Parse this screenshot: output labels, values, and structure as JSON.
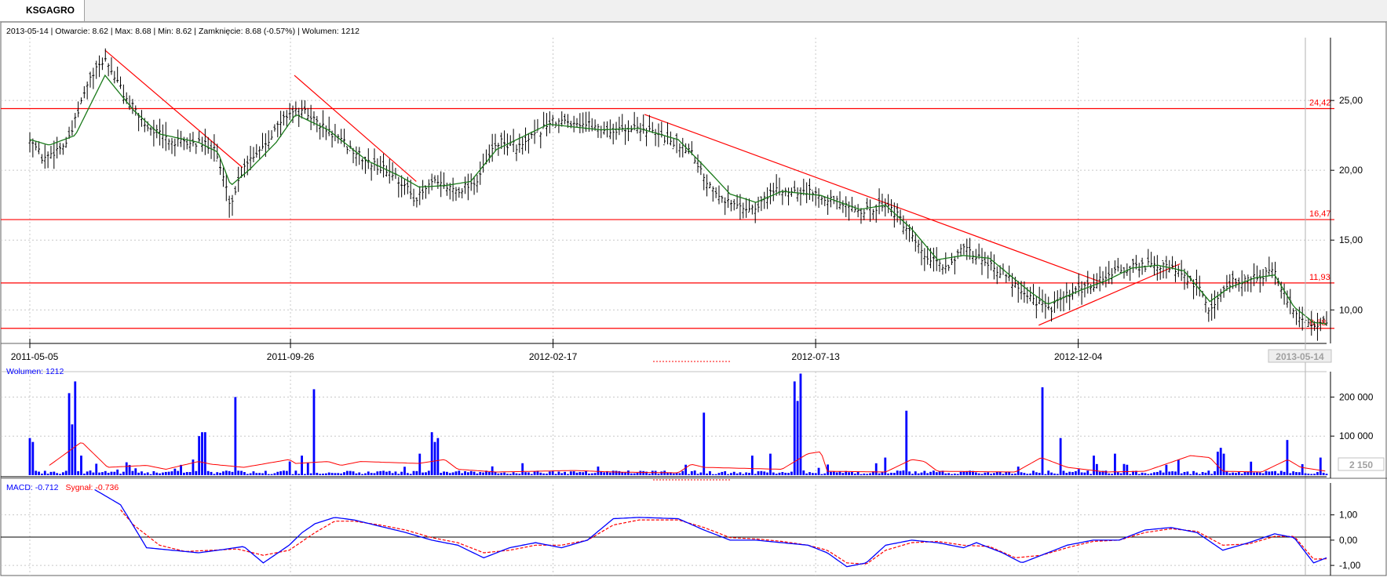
{
  "tab": {
    "label": "KSGAGRO"
  },
  "header": {
    "info": "2013-05-14 | Otwarcie: 8.62 | Max: 8.68 | Min: 8.62 | Zamknięcie: 8.68 (-0.57%)  | Wolumen: 1212"
  },
  "colors": {
    "price_bar": "#000000",
    "ma_line": "#1a7a1a",
    "support_line": "#ff0000",
    "volume_bar": "#0000ff",
    "volume_avg": "#ff0000",
    "macd_line": "#0000ff",
    "signal_line": "#ff0000",
    "grid": "#c8c8c8"
  },
  "chart_data": [
    {
      "type": "ohlc",
      "title": "",
      "x_ticks": [
        "2011-05-05",
        "2011-09-26",
        "2012-02-17",
        "2012-07-13",
        "2012-12-04"
      ],
      "last_date_label": "2013-05-14",
      "y_ticks": [
        "25,00",
        "20,00",
        "15,00",
        "10,00"
      ],
      "ylim": [
        7.6,
        29.5
      ],
      "horizontal_levels": [
        {
          "label": "24,42",
          "value": 24.42
        },
        {
          "label": "16,47",
          "value": 16.47
        },
        {
          "label": "11,93",
          "value": 11.93
        },
        {
          "label": "8,68",
          "value": 8.68
        }
      ],
      "trendlines": [
        {
          "from": [
            0.058,
            28.6
          ],
          "to": [
            0.164,
            20.2
          ]
        },
        {
          "from": [
            0.204,
            26.8
          ],
          "to": [
            0.298,
            19.2
          ]
        },
        {
          "from": [
            0.474,
            24.0
          ],
          "to": [
            0.826,
            12.0
          ]
        },
        {
          "from": [
            0.778,
            8.9
          ],
          "to": [
            0.887,
            13.3
          ]
        }
      ],
      "price_anchors": [
        [
          0.0,
          22.4
        ],
        [
          0.01,
          20.8
        ],
        [
          0.03,
          22.1
        ],
        [
          0.045,
          26.3
        ],
        [
          0.058,
          28.0
        ],
        [
          0.075,
          25.0
        ],
        [
          0.09,
          23.2
        ],
        [
          0.11,
          22.0
        ],
        [
          0.13,
          21.9
        ],
        [
          0.142,
          21.8
        ],
        [
          0.155,
          17.5
        ],
        [
          0.165,
          20.4
        ],
        [
          0.18,
          21.8
        ],
        [
          0.2,
          24.2
        ],
        [
          0.213,
          24.1
        ],
        [
          0.23,
          22.8
        ],
        [
          0.26,
          20.6
        ],
        [
          0.28,
          19.8
        ],
        [
          0.298,
          17.9
        ],
        [
          0.31,
          19.1
        ],
        [
          0.33,
          18.6
        ],
        [
          0.345,
          19.3
        ],
        [
          0.36,
          22.0
        ],
        [
          0.38,
          21.7
        ],
        [
          0.4,
          23.4
        ],
        [
          0.42,
          23.5
        ],
        [
          0.45,
          22.8
        ],
        [
          0.47,
          23.1
        ],
        [
          0.49,
          22.3
        ],
        [
          0.51,
          21.5
        ],
        [
          0.52,
          19.5
        ],
        [
          0.54,
          17.6
        ],
        [
          0.56,
          17.2
        ],
        [
          0.57,
          18.4
        ],
        [
          0.59,
          18.6
        ],
        [
          0.61,
          18.3
        ],
        [
          0.63,
          17.3
        ],
        [
          0.65,
          17.1
        ],
        [
          0.66,
          17.8
        ],
        [
          0.67,
          16.6
        ],
        [
          0.69,
          13.8
        ],
        [
          0.705,
          13.0
        ],
        [
          0.72,
          14.3
        ],
        [
          0.74,
          13.4
        ],
        [
          0.77,
          11.1
        ],
        [
          0.785,
          10.0
        ],
        [
          0.8,
          11.0
        ],
        [
          0.82,
          11.8
        ],
        [
          0.835,
          12.7
        ],
        [
          0.86,
          13.2
        ],
        [
          0.88,
          13.0
        ],
        [
          0.9,
          11.7
        ],
        [
          0.91,
          10.0
        ],
        [
          0.925,
          12.0
        ],
        [
          0.94,
          12.2
        ],
        [
          0.96,
          12.7
        ],
        [
          0.97,
          10.6
        ],
        [
          0.985,
          9.0
        ],
        [
          1.0,
          9.1
        ]
      ],
      "ma_anchors": [
        [
          0.0,
          22.2
        ],
        [
          0.015,
          21.8
        ],
        [
          0.035,
          22.5
        ],
        [
          0.058,
          26.8
        ],
        [
          0.08,
          24.3
        ],
        [
          0.1,
          22.6
        ],
        [
          0.13,
          22.0
        ],
        [
          0.145,
          21.3
        ],
        [
          0.155,
          18.9
        ],
        [
          0.17,
          20.1
        ],
        [
          0.19,
          22.0
        ],
        [
          0.205,
          24.0
        ],
        [
          0.23,
          22.9
        ],
        [
          0.26,
          20.7
        ],
        [
          0.285,
          19.6
        ],
        [
          0.3,
          18.8
        ],
        [
          0.32,
          18.9
        ],
        [
          0.34,
          19.2
        ],
        [
          0.36,
          21.5
        ],
        [
          0.4,
          23.3
        ],
        [
          0.44,
          22.9
        ],
        [
          0.47,
          23.0
        ],
        [
          0.5,
          22.2
        ],
        [
          0.52,
          20.3
        ],
        [
          0.54,
          18.3
        ],
        [
          0.56,
          17.7
        ],
        [
          0.58,
          18.5
        ],
        [
          0.61,
          18.2
        ],
        [
          0.64,
          17.2
        ],
        [
          0.66,
          17.5
        ],
        [
          0.68,
          15.8
        ],
        [
          0.7,
          13.6
        ],
        [
          0.72,
          13.9
        ],
        [
          0.74,
          13.7
        ],
        [
          0.77,
          11.4
        ],
        [
          0.785,
          10.4
        ],
        [
          0.81,
          11.4
        ],
        [
          0.83,
          12.1
        ],
        [
          0.85,
          13.0
        ],
        [
          0.87,
          13.2
        ],
        [
          0.89,
          12.8
        ],
        [
          0.91,
          10.6
        ],
        [
          0.925,
          11.6
        ],
        [
          0.945,
          12.3
        ],
        [
          0.96,
          12.5
        ],
        [
          0.975,
          10.2
        ],
        [
          0.99,
          9.1
        ],
        [
          1.0,
          9.0
        ]
      ],
      "marker_label": "8,68"
    },
    {
      "type": "bar",
      "title": "Wolumen: 1212",
      "y_ticks": [
        "200 000",
        "100 000"
      ],
      "ylim": [
        0,
        265000
      ],
      "last_value_label": "2 150",
      "spikes": [
        [
          0.0,
          95000
        ],
        [
          0.003,
          85000
        ],
        [
          0.03,
          210000
        ],
        [
          0.033,
          130000
        ],
        [
          0.036,
          240000
        ],
        [
          0.04,
          50000
        ],
        [
          0.125,
          40000
        ],
        [
          0.13,
          100000
        ],
        [
          0.134,
          110000
        ],
        [
          0.158,
          200000
        ],
        [
          0.2,
          35000
        ],
        [
          0.21,
          50000
        ],
        [
          0.218,
          220000
        ],
        [
          0.3,
          55000
        ],
        [
          0.31,
          110000
        ],
        [
          0.312,
          85000
        ],
        [
          0.315,
          95000
        ],
        [
          0.52,
          160000
        ],
        [
          0.556,
          50000
        ],
        [
          0.57,
          55000
        ],
        [
          0.59,
          240000
        ],
        [
          0.593,
          190000
        ],
        [
          0.595,
          260000
        ],
        [
          0.66,
          45000
        ],
        [
          0.675,
          165000
        ],
        [
          0.78,
          225000
        ],
        [
          0.796,
          95000
        ],
        [
          0.82,
          50000
        ],
        [
          0.836,
          55000
        ],
        [
          0.885,
          40000
        ],
        [
          0.915,
          60000
        ],
        [
          0.918,
          70000
        ],
        [
          0.92,
          55000
        ],
        [
          0.97,
          90000
        ],
        [
          0.995,
          45000
        ]
      ],
      "avg_anchors": [
        [
          0.015,
          25000
        ],
        [
          0.04,
          85000
        ],
        [
          0.06,
          20000
        ],
        [
          0.09,
          25000
        ],
        [
          0.105,
          15000
        ],
        [
          0.13,
          35000
        ],
        [
          0.14,
          28000
        ],
        [
          0.165,
          20000
        ],
        [
          0.2,
          40000
        ],
        [
          0.205,
          30000
        ],
        [
          0.23,
          35000
        ],
        [
          0.24,
          25000
        ],
        [
          0.255,
          35000
        ],
        [
          0.3,
          30000
        ],
        [
          0.32,
          40000
        ],
        [
          0.33,
          15000
        ],
        [
          0.36,
          8000
        ],
        [
          0.42,
          12000
        ],
        [
          0.45,
          8000
        ],
        [
          0.5,
          6000
        ],
        [
          0.51,
          28000
        ],
        [
          0.52,
          20000
        ],
        [
          0.58,
          15000
        ],
        [
          0.6,
          55000
        ],
        [
          0.61,
          60000
        ],
        [
          0.615,
          10000
        ],
        [
          0.66,
          8000
        ],
        [
          0.68,
          40000
        ],
        [
          0.69,
          35000
        ],
        [
          0.7,
          10000
        ],
        [
          0.76,
          8000
        ],
        [
          0.78,
          45000
        ],
        [
          0.8,
          20000
        ],
        [
          0.83,
          8000
        ],
        [
          0.86,
          10000
        ],
        [
          0.895,
          50000
        ],
        [
          0.91,
          45000
        ],
        [
          0.92,
          10000
        ],
        [
          0.95,
          8000
        ],
        [
          0.97,
          40000
        ],
        [
          0.98,
          20000
        ],
        [
          1.0,
          10000
        ]
      ],
      "base_level": 6000
    },
    {
      "type": "line",
      "title": "MACD: -0.712  Sygnał: -0.736",
      "y_ticks": [
        "1,00",
        "0,00",
        "-1,00"
      ],
      "ylim": [
        -1.4,
        2.2
      ],
      "series": [
        {
          "name": "MACD: -0.712",
          "anchors": [
            [
              0.05,
              2.0
            ],
            [
              0.07,
              1.4
            ],
            [
              0.09,
              -0.3
            ],
            [
              0.11,
              -0.4
            ],
            [
              0.13,
              -0.5
            ],
            [
              0.145,
              -0.4
            ],
            [
              0.165,
              -0.25
            ],
            [
              0.18,
              -0.9
            ],
            [
              0.2,
              -0.2
            ],
            [
              0.21,
              0.3
            ],
            [
              0.22,
              0.65
            ],
            [
              0.235,
              0.9
            ],
            [
              0.25,
              0.8
            ],
            [
              0.27,
              0.55
            ],
            [
              0.29,
              0.3
            ],
            [
              0.31,
              0.0
            ],
            [
              0.33,
              -0.2
            ],
            [
              0.35,
              -0.7
            ],
            [
              0.37,
              -0.3
            ],
            [
              0.39,
              -0.1
            ],
            [
              0.41,
              -0.3
            ],
            [
              0.43,
              0.0
            ],
            [
              0.45,
              0.85
            ],
            [
              0.47,
              0.9
            ],
            [
              0.5,
              0.85
            ],
            [
              0.52,
              0.4
            ],
            [
              0.54,
              0.0
            ],
            [
              0.56,
              0.0
            ],
            [
              0.58,
              -0.1
            ],
            [
              0.6,
              -0.2
            ],
            [
              0.615,
              -0.5
            ],
            [
              0.63,
              -1.05
            ],
            [
              0.645,
              -0.9
            ],
            [
              0.66,
              -0.2
            ],
            [
              0.68,
              0.0
            ],
            [
              0.7,
              -0.1
            ],
            [
              0.72,
              -0.3
            ],
            [
              0.73,
              -0.1
            ],
            [
              0.75,
              -0.5
            ],
            [
              0.765,
              -0.9
            ],
            [
              0.78,
              -0.6
            ],
            [
              0.8,
              -0.2
            ],
            [
              0.82,
              0.0
            ],
            [
              0.84,
              0.0
            ],
            [
              0.86,
              0.4
            ],
            [
              0.88,
              0.5
            ],
            [
              0.9,
              0.3
            ],
            [
              0.92,
              -0.4
            ],
            [
              0.94,
              -0.1
            ],
            [
              0.96,
              0.25
            ],
            [
              0.975,
              0.1
            ],
            [
              0.99,
              -0.9
            ],
            [
              1.0,
              -0.7
            ]
          ]
        },
        {
          "name": "Sygnał: -0.736",
          "anchors": [
            [
              0.07,
              1.2
            ],
            [
              0.08,
              0.6
            ],
            [
              0.1,
              -0.2
            ],
            [
              0.12,
              -0.45
            ],
            [
              0.14,
              -0.4
            ],
            [
              0.16,
              -0.35
            ],
            [
              0.18,
              -0.6
            ],
            [
              0.2,
              -0.4
            ],
            [
              0.22,
              0.3
            ],
            [
              0.235,
              0.75
            ],
            [
              0.25,
              0.75
            ],
            [
              0.27,
              0.6
            ],
            [
              0.29,
              0.4
            ],
            [
              0.31,
              0.1
            ],
            [
              0.33,
              -0.1
            ],
            [
              0.35,
              -0.5
            ],
            [
              0.37,
              -0.4
            ],
            [
              0.39,
              -0.2
            ],
            [
              0.41,
              -0.2
            ],
            [
              0.43,
              0.0
            ],
            [
              0.45,
              0.6
            ],
            [
              0.47,
              0.8
            ],
            [
              0.5,
              0.8
            ],
            [
              0.52,
              0.5
            ],
            [
              0.54,
              0.1
            ],
            [
              0.56,
              0.05
            ],
            [
              0.58,
              -0.05
            ],
            [
              0.6,
              -0.2
            ],
            [
              0.615,
              -0.4
            ],
            [
              0.63,
              -0.9
            ],
            [
              0.645,
              -0.95
            ],
            [
              0.66,
              -0.4
            ],
            [
              0.68,
              -0.1
            ],
            [
              0.7,
              -0.05
            ],
            [
              0.72,
              -0.2
            ],
            [
              0.74,
              -0.25
            ],
            [
              0.76,
              -0.7
            ],
            [
              0.78,
              -0.6
            ],
            [
              0.8,
              -0.3
            ],
            [
              0.82,
              -0.05
            ],
            [
              0.84,
              0.0
            ],
            [
              0.86,
              0.3
            ],
            [
              0.88,
              0.45
            ],
            [
              0.9,
              0.35
            ],
            [
              0.92,
              -0.2
            ],
            [
              0.94,
              -0.15
            ],
            [
              0.96,
              0.15
            ],
            [
              0.975,
              0.15
            ],
            [
              0.99,
              -0.75
            ],
            [
              1.0,
              -0.74
            ]
          ]
        }
      ]
    }
  ]
}
